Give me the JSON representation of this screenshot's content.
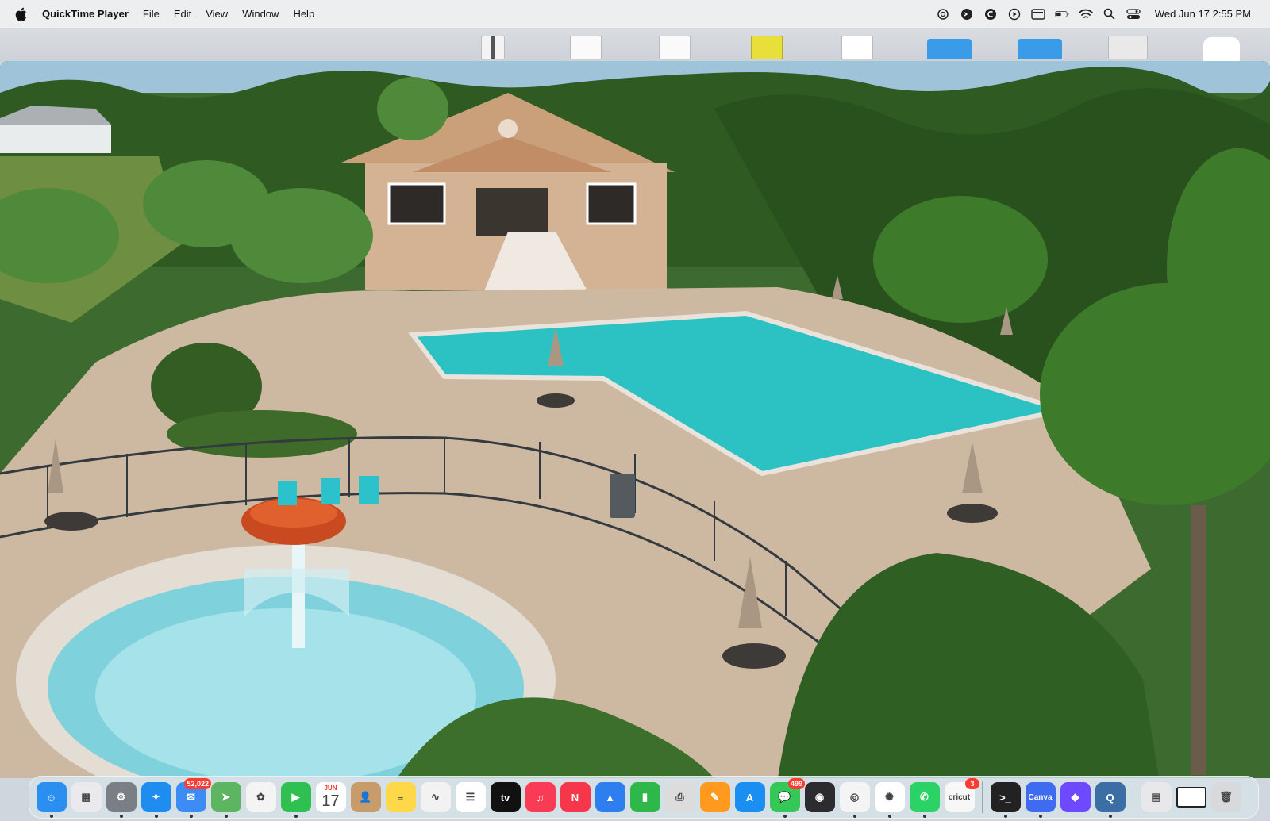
{
  "menubar": {
    "app_name": "QuickTime Player",
    "menus": [
      "File",
      "Edit",
      "View",
      "Window",
      "Help"
    ],
    "status_icons": [
      "chatgpt-icon",
      "script-icon",
      "c-circle-icon",
      "play-circle-icon",
      "display-icon",
      "battery-icon",
      "wifi-icon",
      "search-icon",
      "control-center-icon"
    ],
    "clock": "Wed Jun 17  2:55 PM"
  },
  "dock": {
    "apps": [
      {
        "name": "finder",
        "color": "#2a8ff0",
        "glyph": "☺"
      },
      {
        "name": "launchpad",
        "color": "#e9e9ee",
        "glyph": "▦"
      },
      {
        "name": "system-settings",
        "color": "#7a7f86",
        "glyph": "⚙"
      },
      {
        "name": "safari",
        "color": "#1f8df0",
        "glyph": "✦"
      },
      {
        "name": "mail",
        "color": "#3c8cf5",
        "glyph": "✉",
        "badge": "52,022"
      },
      {
        "name": "maps",
        "color": "#5db561",
        "glyph": "➤"
      },
      {
        "name": "photos",
        "color": "#f4f4f4",
        "glyph": "✿"
      },
      {
        "name": "facetime",
        "color": "#2fc051",
        "glyph": "▶"
      },
      {
        "name": "calendar",
        "color": "#ffffff",
        "glyph": "",
        "calendar_month": "JUN",
        "calendar_day": "17"
      },
      {
        "name": "contacts",
        "color": "#c79b6a",
        "glyph": "👤"
      },
      {
        "name": "notes",
        "color": "#ffd84a",
        "glyph": "≡"
      },
      {
        "name": "freeform",
        "color": "#f2f2f2",
        "glyph": "∿"
      },
      {
        "name": "reminders",
        "color": "#ffffff",
        "glyph": "☰"
      },
      {
        "name": "apple-tv",
        "color": "#111111",
        "glyph": "tv"
      },
      {
        "name": "music",
        "color": "#fa3b55",
        "glyph": "♫"
      },
      {
        "name": "news",
        "color": "#f5364b",
        "glyph": "N"
      },
      {
        "name": "keynote",
        "color": "#2d7ff0",
        "glyph": "▲"
      },
      {
        "name": "numbers",
        "color": "#2eb84a",
        "glyph": "▮"
      },
      {
        "name": "printer",
        "color": "#dcdcdc",
        "glyph": "⎙"
      },
      {
        "name": "pages",
        "color": "#ff9a1f",
        "glyph": "✎"
      },
      {
        "name": "app-store",
        "color": "#1b8ef2",
        "glyph": "A"
      },
      {
        "name": "messages",
        "color": "#36c759",
        "glyph": "💬",
        "badge": "499"
      },
      {
        "name": "obs",
        "color": "#2b2b30",
        "glyph": "◉"
      },
      {
        "name": "chrome",
        "color": "#f4f4f4",
        "glyph": "◎"
      },
      {
        "name": "chatgpt",
        "color": "#ffffff",
        "glyph": "✺"
      },
      {
        "name": "whatsapp",
        "color": "#2bd366",
        "glyph": "✆"
      },
      {
        "name": "cricut",
        "color": "#f7f7f7",
        "glyph": "cricut",
        "badge": "3"
      }
    ],
    "recent": [
      {
        "name": "terminal",
        "color": "#222222",
        "glyph": ">_"
      },
      {
        "name": "canva",
        "color": "#3e6bef",
        "glyph": "Canva"
      },
      {
        "name": "proton-drive",
        "color": "#6d4aff",
        "glyph": "◆"
      },
      {
        "name": "quicktime",
        "color": "#3b6ea5",
        "glyph": "Q"
      }
    ],
    "folders": [
      {
        "name": "downloads-stack",
        "color": "#e8e8ea",
        "glyph": "▤"
      },
      {
        "name": "screen-window",
        "color": "#ffffff",
        "glyph": ""
      },
      {
        "name": "trash",
        "color": "#d7d9dc",
        "glyph": "🗑"
      }
    ]
  }
}
